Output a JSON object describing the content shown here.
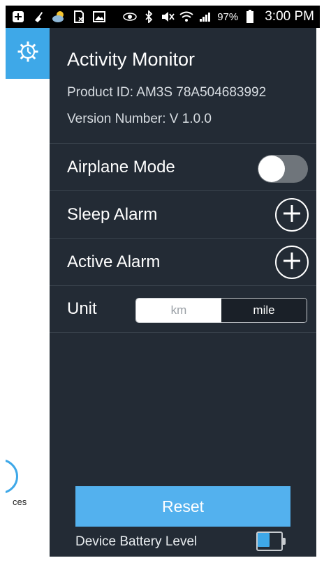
{
  "status_bar": {
    "icons": [
      "add-box-icon",
      "broom-icon",
      "weather-icon",
      "sim-card-icon",
      "image-icon",
      "eye-icon",
      "bluetooth-icon",
      "mute-icon",
      "wifi-icon",
      "signal-icon",
      "battery-icon"
    ],
    "battery_percent": "97%",
    "time": "3:00 PM"
  },
  "behind_panel": {
    "partial_label": "ces"
  },
  "settings": {
    "title": "Activity Monitor",
    "product_id": "Product ID: AM3S 78A504683992",
    "version": "Version Number: V 1.0.0",
    "rows": [
      {
        "label": "Airplane Mode",
        "control": "toggle",
        "state": "off"
      },
      {
        "label": "Sleep Alarm",
        "control": "add-button"
      },
      {
        "label": "Active Alarm",
        "control": "add-button"
      },
      {
        "label": "Unit",
        "control": "segmented",
        "options": [
          "km",
          "mile"
        ],
        "selected": "mile"
      }
    ],
    "reset_label": "Reset",
    "battery_label": "Device Battery Level",
    "battery_level": 0.5
  },
  "colors": {
    "accent": "#3ea8e8",
    "reset_button": "#53b1ee",
    "panel_bg": "#232b35",
    "status_bar_bg": "#000000"
  }
}
